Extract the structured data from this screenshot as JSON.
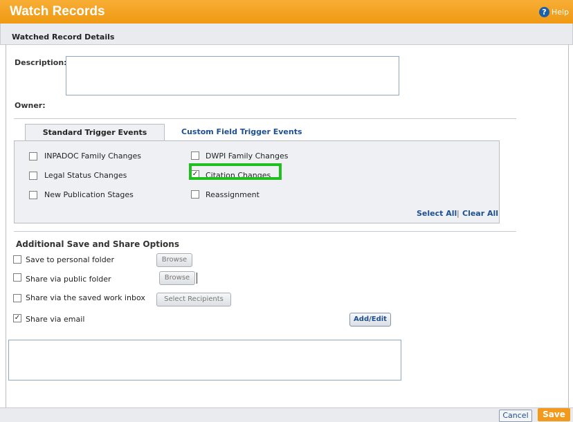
{
  "window": {
    "title": "Watch Records",
    "help_label": "Help"
  },
  "section_title": "Watched Record Details",
  "description": {
    "label": "Description:",
    "value": ""
  },
  "owner": {
    "label": "Owner:",
    "value": ""
  },
  "tabs": [
    {
      "label": "Standard Trigger Events",
      "active": true
    },
    {
      "label": "Custom Field Trigger Events",
      "active": false
    }
  ],
  "triggers": {
    "left": [
      {
        "label": "INPADOC Family Changes",
        "checked": false
      },
      {
        "label": "Legal Status Changes",
        "checked": false
      },
      {
        "label": "New Publication Stages",
        "checked": false
      }
    ],
    "right": [
      {
        "label": "DWPI Family Changes",
        "checked": false
      },
      {
        "label": "Citation Changes",
        "checked": true
      },
      {
        "label": "Reassignment",
        "checked": false
      }
    ],
    "select_all": "Select All",
    "separator": "|",
    "clear_all": "Clear All"
  },
  "share": {
    "title": "Additional Save and Share Options",
    "options": [
      {
        "label": "Save to personal folder",
        "checked": false,
        "button": "Browse"
      },
      {
        "label": "Share via public folder",
        "checked": false,
        "button": "Browse"
      },
      {
        "label": "Share via the saved work inbox",
        "checked": false,
        "button": "Select Recipients"
      },
      {
        "label": "Share via email",
        "checked": true,
        "button": "Add/Edit"
      }
    ],
    "email_value": ""
  },
  "footer": {
    "cancel": "Cancel",
    "save": "Save"
  },
  "colors": {
    "header": "#f5a623",
    "highlight": "#1fbf1f",
    "link": "#1f4f8f"
  },
  "check_glyph": "✓"
}
